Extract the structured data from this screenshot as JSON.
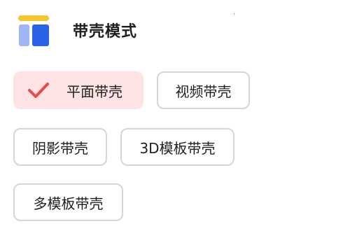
{
  "header": {
    "title": "带壳模式",
    "icon": "layout-template-icon"
  },
  "options": [
    {
      "label": "平面带壳",
      "selected": true
    },
    {
      "label": "视频带壳",
      "selected": false
    },
    {
      "label": "阴影带壳",
      "selected": false
    },
    {
      "label": "3D模板带壳",
      "selected": false
    },
    {
      "label": "多模板带壳",
      "selected": false
    }
  ],
  "colors": {
    "selected_background": "#fde3e3",
    "check": "#e84a4a",
    "border": "#d6d6d6",
    "icon_yellow": "#f7c62b",
    "icon_light_blue": "#9fb6f6",
    "icon_blue": "#2b61e6"
  }
}
